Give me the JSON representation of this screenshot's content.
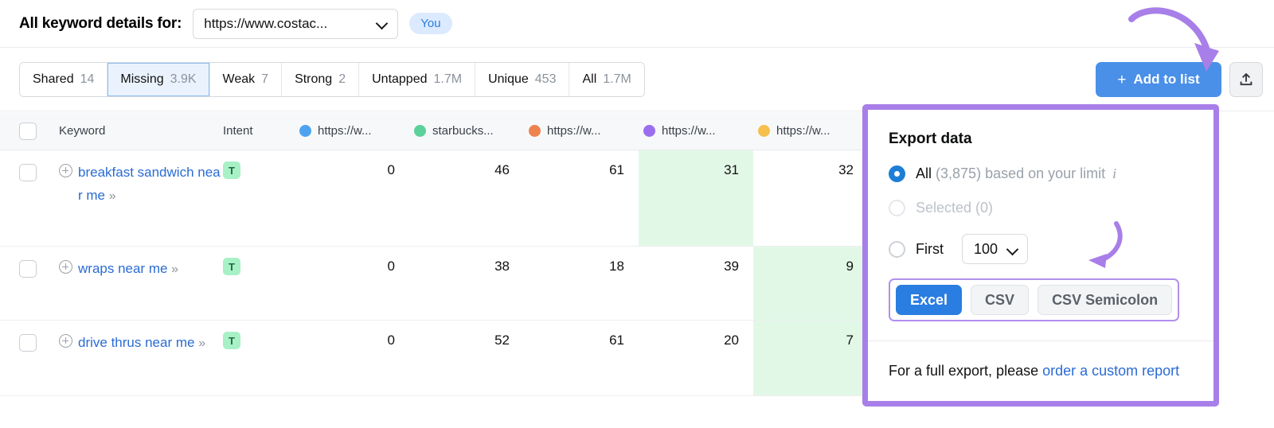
{
  "header": {
    "title": "All keyword details for:",
    "domain_value": "https://www.costac...",
    "you_badge": "You"
  },
  "tabs": [
    {
      "label": "Shared",
      "count": "14",
      "active": false
    },
    {
      "label": "Missing",
      "count": "3.9K",
      "active": true
    },
    {
      "label": "Weak",
      "count": "7",
      "active": false
    },
    {
      "label": "Strong",
      "count": "2",
      "active": false
    },
    {
      "label": "Untapped",
      "count": "1.7M",
      "active": false
    },
    {
      "label": "Unique",
      "count": "453",
      "active": false
    },
    {
      "label": "All",
      "count": "1.7M",
      "active": false
    }
  ],
  "toolbar": {
    "add_to_list_label": "Add to list",
    "add_icon": "plus-icon",
    "export_icon": "upload-icon"
  },
  "table": {
    "columns": [
      {
        "label": "Keyword",
        "dot": null
      },
      {
        "label": "Intent",
        "dot": null
      },
      {
        "label": "https://w...",
        "dot": "#4da3f0"
      },
      {
        "label": "starbucks...",
        "dot": "#5cd19a"
      },
      {
        "label": "https://w...",
        "dot": "#ef8350"
      },
      {
        "label": "https://w...",
        "dot": "#9b6ef0"
      },
      {
        "label": "https://w...",
        "dot": "#f5c04c"
      }
    ],
    "rows": [
      {
        "keyword": "breakfast sandwich near me",
        "intent": "T",
        "values": [
          "0",
          "46",
          "61",
          "31",
          "32"
        ],
        "highlight_index": 3
      },
      {
        "keyword": "wraps near me",
        "intent": "T",
        "values": [
          "0",
          "38",
          "18",
          "39",
          "9"
        ],
        "highlight_index": 4
      },
      {
        "keyword": "drive thrus near me",
        "intent": "T",
        "values": [
          "0",
          "52",
          "61",
          "20",
          "7"
        ],
        "highlight_index": 4
      }
    ]
  },
  "export_panel": {
    "title": "Export data",
    "options": [
      {
        "label": "All",
        "detail": "(3,875) based on your limit",
        "selected": true,
        "disabled": false,
        "info_icon": "info-icon"
      },
      {
        "label": "Selected (0)",
        "detail": "",
        "selected": false,
        "disabled": true
      },
      {
        "label": "First",
        "detail": "",
        "selected": false,
        "disabled": false
      }
    ],
    "first_count": "100",
    "formats": [
      {
        "label": "Excel",
        "primary": true
      },
      {
        "label": "CSV",
        "primary": false
      },
      {
        "label": "CSV Semicolon",
        "primary": false
      }
    ],
    "footer_prefix": "For a full export, please ",
    "footer_link": "order a custom report"
  },
  "colors": {
    "accent_blue": "#2a7de1",
    "annotation_purple": "#a87fe8",
    "highlight_green": "#e2f8e6",
    "intent_green_bg": "#a8f0c6"
  }
}
